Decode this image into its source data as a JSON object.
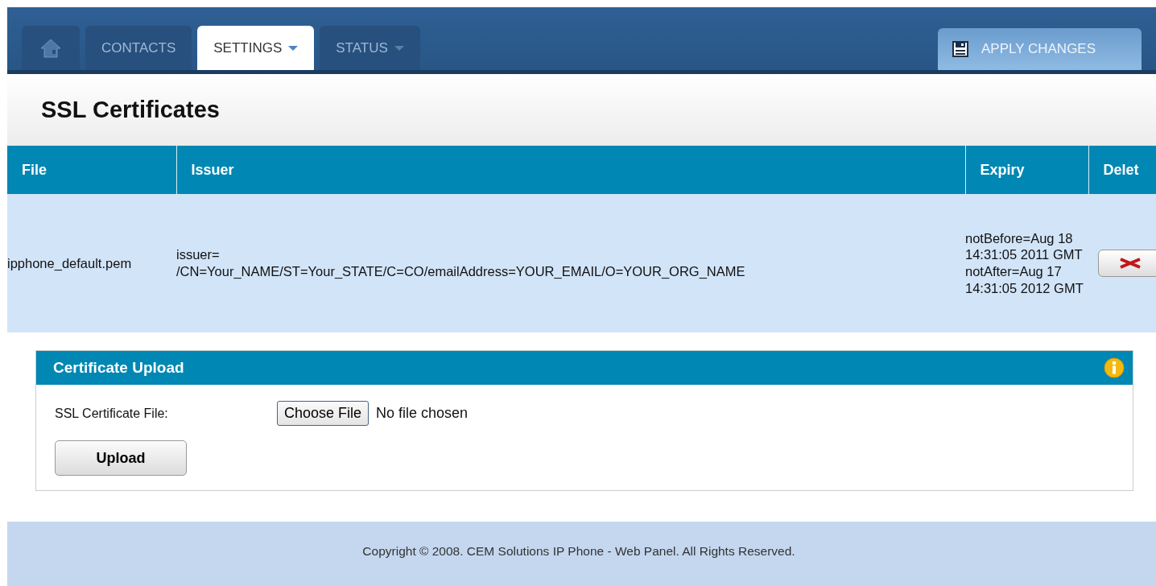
{
  "nav": {
    "tabs": [
      {
        "kind": "home",
        "selected": false
      },
      {
        "kind": "text",
        "label": "CONTACTS",
        "selected": false
      },
      {
        "kind": "menu",
        "label": "SETTINGS",
        "selected": true
      },
      {
        "kind": "menu",
        "label": "STATUS",
        "selected": false
      }
    ],
    "apply_button": "APPLY CHANGES"
  },
  "page_title": "SSL Certificates",
  "table": {
    "columns": [
      "File",
      "Issuer",
      "Expiry",
      "Delet"
    ],
    "rows": [
      {
        "file": "ipphone_default.pem",
        "issuer": "issuer=\n/CN=Your_NAME/ST=Your_STATE/C=CO/emailAddress=YOUR_EMAIL/O=YOUR_ORG_NAME",
        "expiry": "notBefore=Aug 18 14:31:05 2011 GMT notAfter=Aug 17 14:31:05 2012 GMT"
      }
    ]
  },
  "upload_panel": {
    "title": "Certificate Upload",
    "field_label": "SSL Certificate File:",
    "file_button": "Choose File",
    "file_status": "No file chosen",
    "upload_button": "Upload"
  },
  "footer": "Copyright © 2008. CEM Solutions IP Phone - Web Panel. All Rights Reserved."
}
